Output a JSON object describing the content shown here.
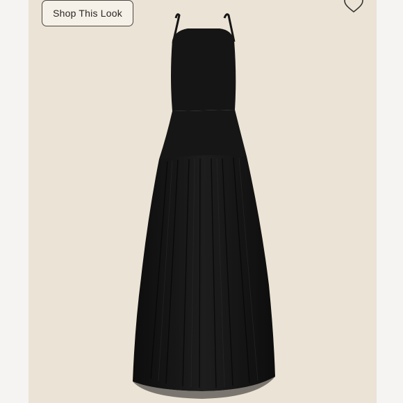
{
  "shop_button": {
    "label": "Shop This Look"
  },
  "icons": {
    "favorite": "heart-outline-icon",
    "zoom": "zoom-plus-icon"
  },
  "colors": {
    "photo_background": "#ebe3d5",
    "dress": "#151515",
    "button_border": "#4a4640"
  }
}
